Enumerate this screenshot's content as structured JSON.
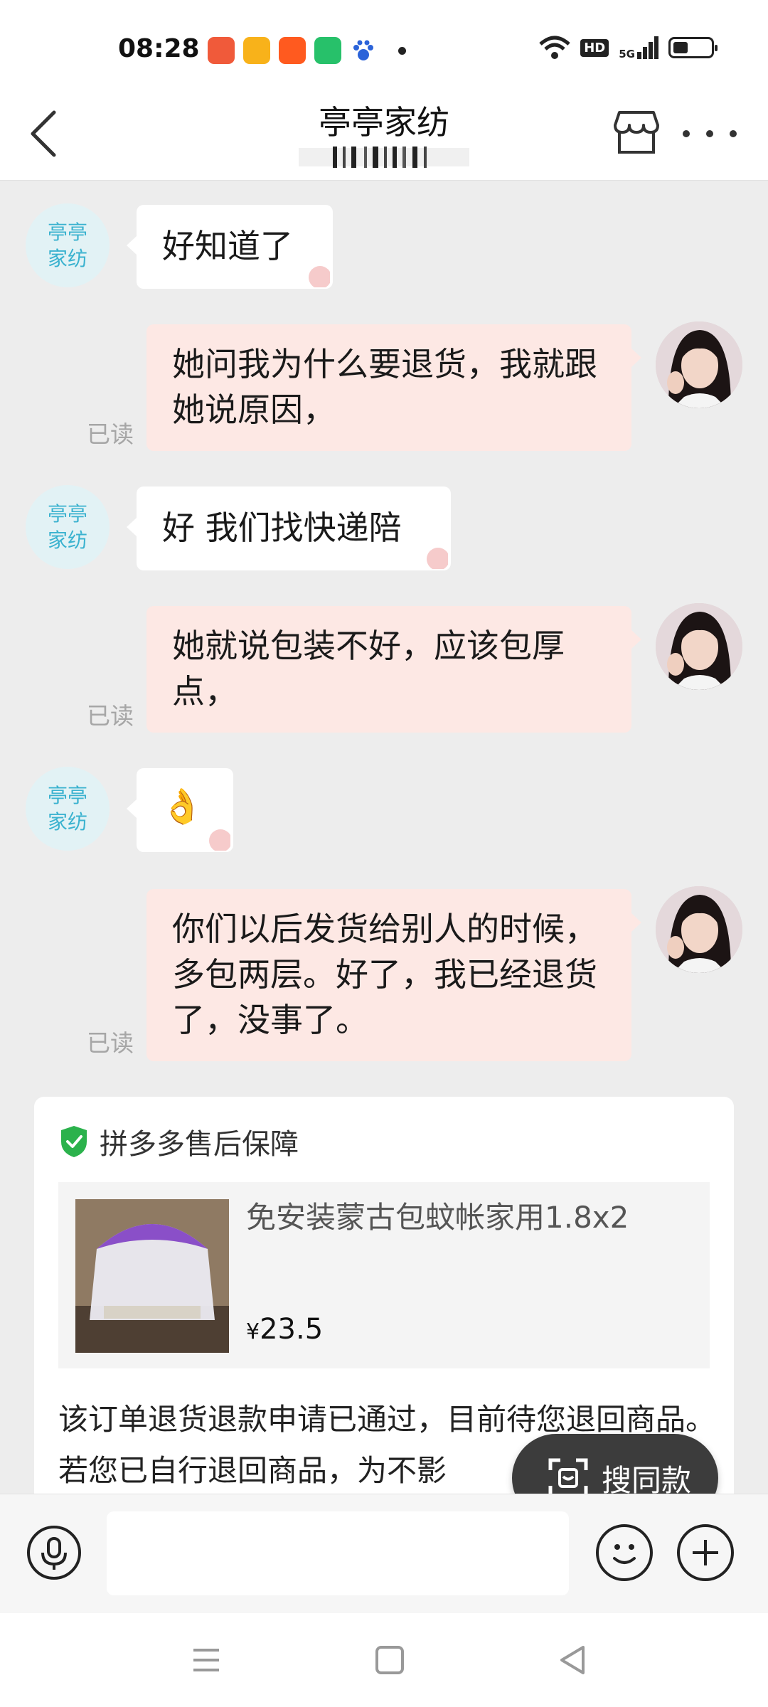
{
  "status_bar": {
    "time": "08:28",
    "app_icons": [
      {
        "name": "app-icon-1",
        "color": "#f05a3a"
      },
      {
        "name": "app-icon-2",
        "color": "#f8b21a"
      },
      {
        "name": "app-icon-taobao",
        "color": "#ff5a1f"
      },
      {
        "name": "app-icon-4",
        "color": "#27c16a"
      },
      {
        "name": "baidu-paw-icon",
        "color": "#2b63d9"
      }
    ],
    "network_badge": "HD",
    "signal_type": "5G",
    "battery_level": 0.4
  },
  "header": {
    "title": "亭亭家纺"
  },
  "shop_avatar_text": "亭亭\n家纺",
  "messages": [
    {
      "side": "left",
      "text": "好知道了"
    },
    {
      "side": "right",
      "text": "她问我为什么要退货，我就跟她说原因，",
      "read": "已读"
    },
    {
      "side": "left",
      "text": "好 我们找快递陪"
    },
    {
      "side": "right",
      "text": "她就说包装不好，应该包厚点，",
      "read": "已读"
    },
    {
      "side": "left",
      "text": "👌"
    },
    {
      "side": "right",
      "text": "你们以后发货给别人的时候，多包两层。好了，我已经退货了，没事了。",
      "read": "已读"
    }
  ],
  "card": {
    "header": "拼多多售后保障",
    "product_title": "免安装蒙古包蚊帐家用1.8x2",
    "price_symbol": "¥",
    "price_value": "23.5",
    "body": "该订单退货退款申请已通过，目前待您退回商品。若您已自行退回商品，为不影"
  },
  "search_same_label": "搜同款",
  "input": {
    "placeholder": ""
  },
  "colors": {
    "shop_text": "#3ab2cf",
    "user_bubble": "#fde8e4",
    "shield_green": "#2bb24c"
  }
}
